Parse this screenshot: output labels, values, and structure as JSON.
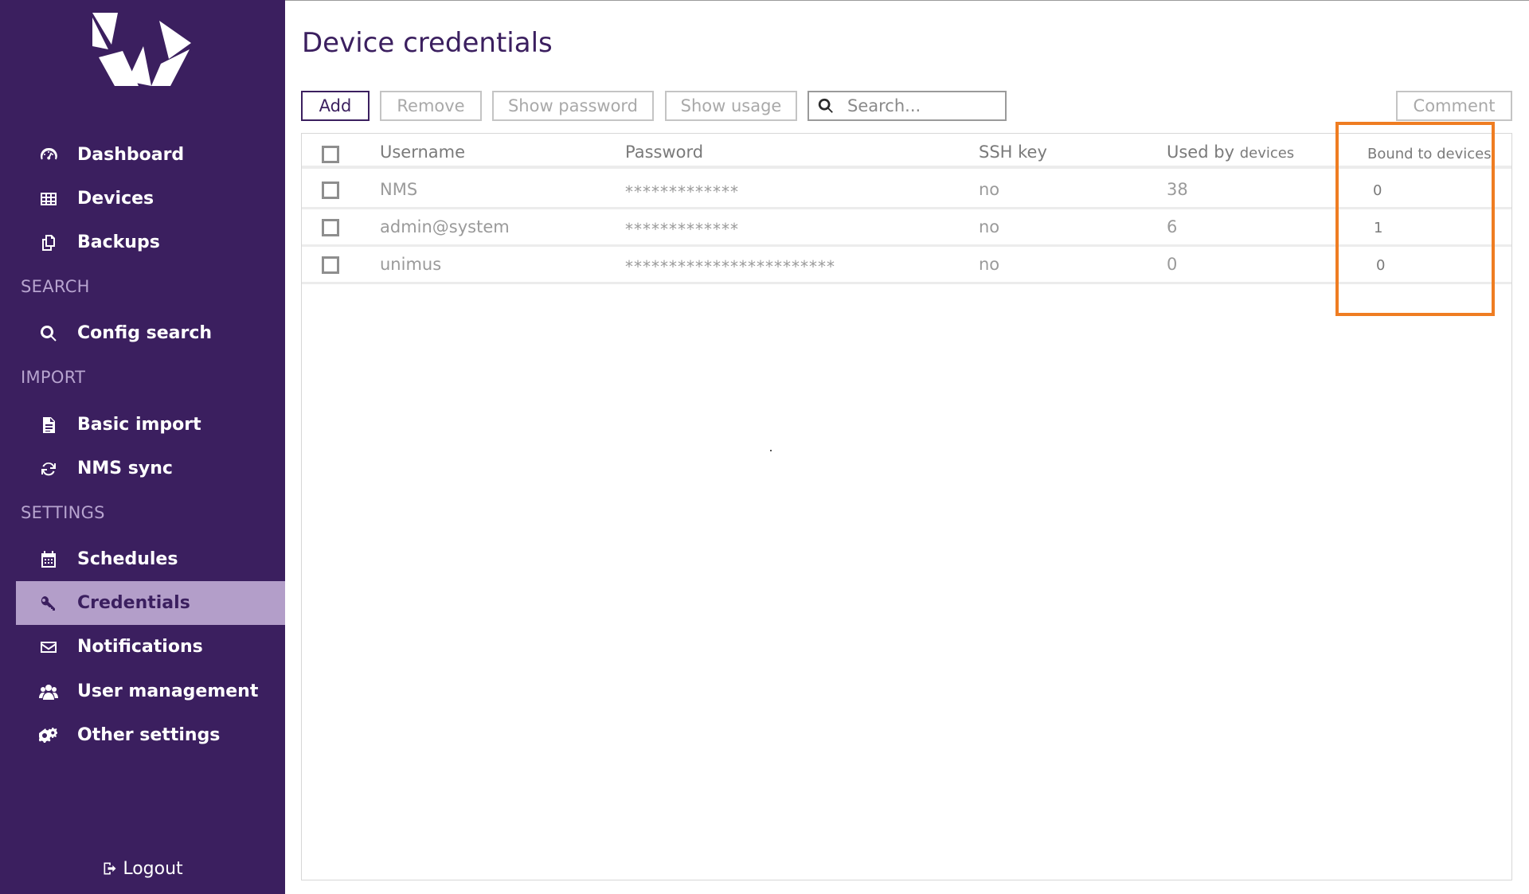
{
  "sidebar": {
    "items_top": [
      {
        "label": "Dashboard",
        "icon": "dashboard-icon"
      },
      {
        "label": "Devices",
        "icon": "devices-icon"
      },
      {
        "label": "Backups",
        "icon": "backups-icon"
      }
    ],
    "search_section": "SEARCH",
    "config_search": "Config search",
    "import_section": "IMPORT",
    "basic_import": "Basic import",
    "nms_sync": "NMS sync",
    "settings_section": "SETTINGS",
    "settings_items": [
      {
        "label": "Schedules"
      },
      {
        "label": "Credentials",
        "active": true
      },
      {
        "label": "Notifications"
      },
      {
        "label": "User management"
      },
      {
        "label": "Other settings"
      }
    ],
    "logout": "Logout"
  },
  "main": {
    "title": "Device credentials",
    "toolbar": {
      "add": "Add",
      "remove": "Remove",
      "show_password": "Show password",
      "show_usage": "Show usage",
      "search_placeholder": "Search...",
      "comment": "Comment"
    },
    "table": {
      "columns": {
        "username": "Username",
        "password": "Password",
        "ssh_key": "SSH key",
        "used_by_a": "Used by",
        "used_by_b": "devices",
        "bound_to": "Bound to devices"
      },
      "rows": [
        {
          "username": "NMS",
          "password": "*************",
          "ssh_key": "no",
          "used_by": "38",
          "bound": "0"
        },
        {
          "username": "admin@system",
          "password": "*************",
          "ssh_key": "no",
          "used_by": "6",
          "bound": "1"
        },
        {
          "username": "unimus",
          "password": "************************",
          "ssh_key": "no",
          "used_by": "0",
          "bound": "0"
        }
      ]
    }
  },
  "colors": {
    "sidebar_bg": "#3b1f5f",
    "active_item_bg": "#b39ec9",
    "highlight": "#ef7d22"
  }
}
